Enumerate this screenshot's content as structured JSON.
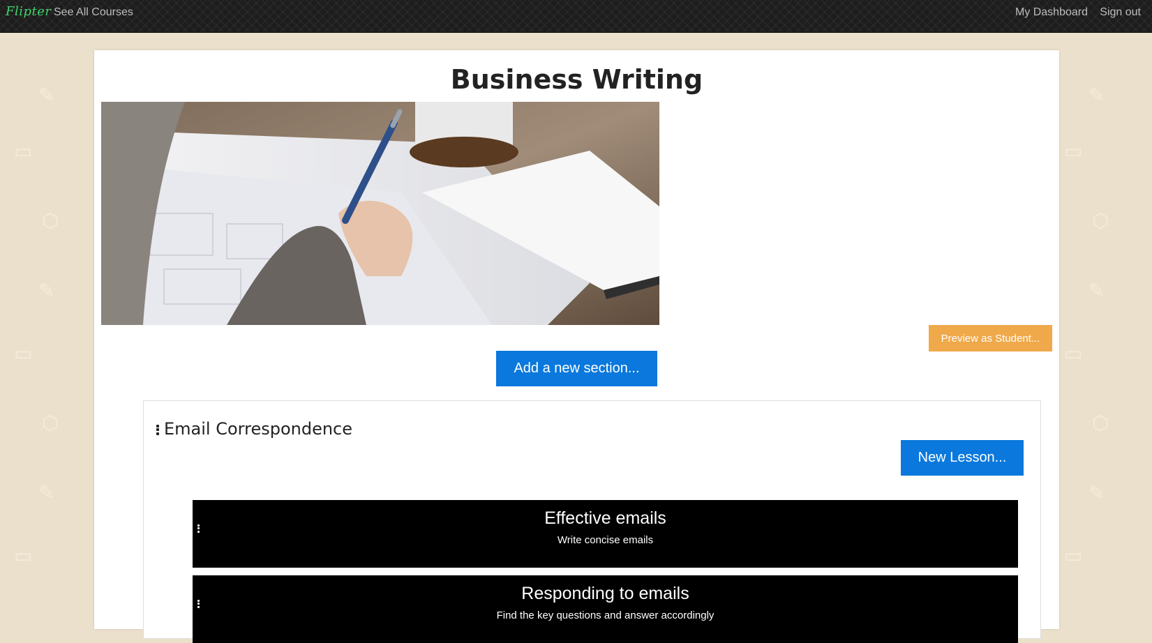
{
  "nav": {
    "brand": "Flipter",
    "see_all_courses": "See All Courses",
    "my_dashboard": "My Dashboard",
    "sign_out": "Sign out"
  },
  "course": {
    "title": "Business Writing",
    "preview_button": "Preview as Student...",
    "add_section_button": "Add a new section..."
  },
  "section": {
    "title": "Email Correspondence",
    "new_lesson_button": "New Lesson...",
    "lessons": [
      {
        "title": "Effective emails",
        "subtitle": "Write concise emails"
      },
      {
        "title": "Responding to emails",
        "subtitle": "Find the key questions and answer accordingly"
      }
    ]
  },
  "colors": {
    "page_bg": "#ebe0cb",
    "navbar_bg": "#1d1d1d",
    "brand": "#3fd66b",
    "primary_button": "#0a78dc",
    "preview_button": "#efa94b",
    "lesson_bg": "#000000"
  }
}
